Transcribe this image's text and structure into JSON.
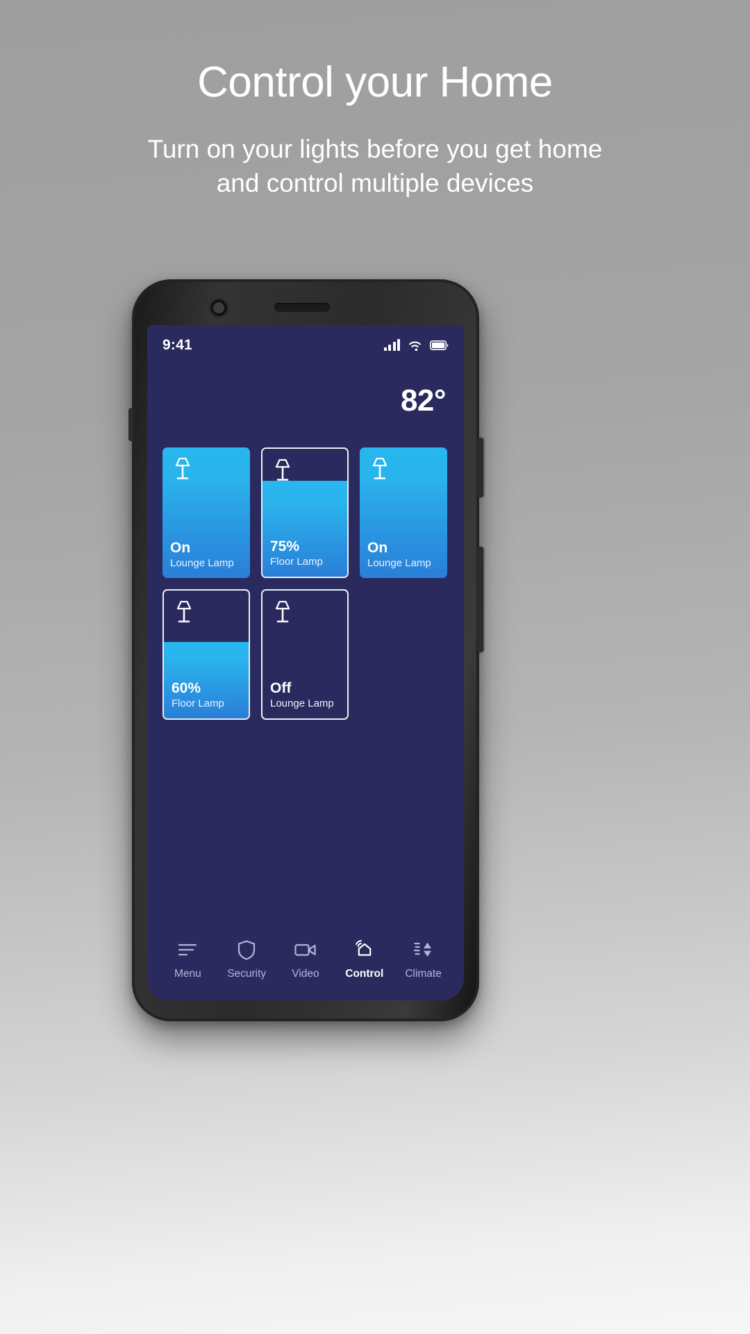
{
  "promo": {
    "headline": "Control your Home",
    "subhead": "Turn on your lights before you get home and control multiple devices"
  },
  "phone": {
    "status_bar": {
      "time": "9:41",
      "icons": [
        "signal-icon",
        "wifi-icon",
        "battery-icon"
      ],
      "signal_bars": 4,
      "battery_level": "full"
    },
    "temperature": "82°",
    "colors": {
      "app_background": "#2b2a5f",
      "card_on_top": "#27b6ee",
      "card_on_bottom": "#2a7fd6",
      "accent_text": "#ffffff",
      "nav_inactive": "#b2b3d8"
    },
    "devices": [
      {
        "value": "On",
        "name": "Lounge Lamp",
        "state": "on",
        "fill_percent": 100,
        "icon": "lamp-icon"
      },
      {
        "value": "75%",
        "name": "Floor Lamp",
        "state": "dimmed",
        "fill_percent": 75,
        "icon": "lamp-icon"
      },
      {
        "value": "On",
        "name": "Lounge Lamp",
        "state": "on",
        "fill_percent": 100,
        "icon": "lamp-icon"
      },
      {
        "value": "60%",
        "name": "Floor Lamp",
        "state": "dimmed",
        "fill_percent": 60,
        "icon": "lamp-icon"
      },
      {
        "value": "Off",
        "name": "Lounge Lamp",
        "state": "off",
        "fill_percent": 0,
        "icon": "lamp-icon"
      }
    ],
    "nav": [
      {
        "label": "Menu",
        "icon": "menu-icon",
        "active": false
      },
      {
        "label": "Security",
        "icon": "shield-icon",
        "active": false
      },
      {
        "label": "Video",
        "icon": "camcorder-icon",
        "active": false
      },
      {
        "label": "Control",
        "icon": "home-wifi-icon",
        "active": true
      },
      {
        "label": "Climate",
        "icon": "climate-icon",
        "active": false
      }
    ]
  }
}
